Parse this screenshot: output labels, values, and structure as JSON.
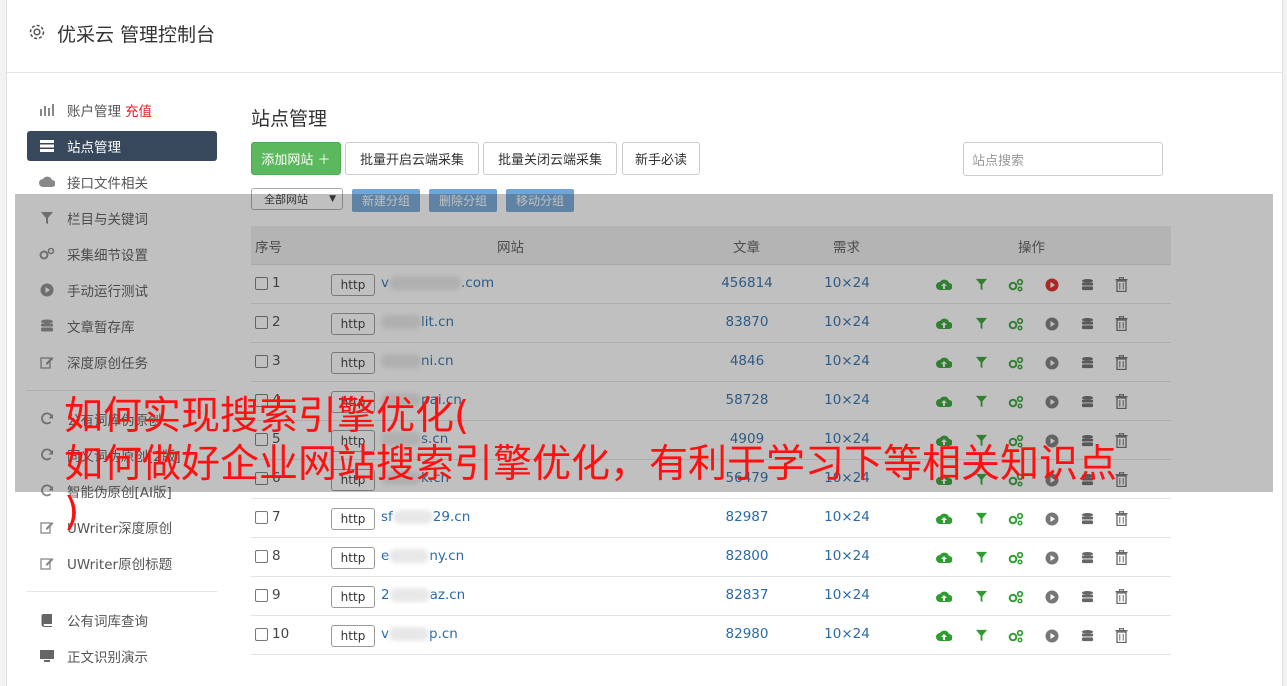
{
  "app": {
    "title": "优采云 管理控制台"
  },
  "sidebar": {
    "items": [
      {
        "label": "账户管理",
        "extra": "充值",
        "icon": "bar-chart-icon"
      },
      {
        "label": "站点管理",
        "icon": "server-icon",
        "active": true
      },
      {
        "label": "接口文件相关",
        "icon": "cloud-upload-icon"
      },
      {
        "label": "栏目与关键词",
        "icon": "filter-icon"
      },
      {
        "label": "采集细节设置",
        "icon": "gears-icon"
      },
      {
        "label": "手动运行测试",
        "icon": "play-circle-icon"
      },
      {
        "label": "文章暂存库",
        "icon": "database-icon"
      },
      {
        "label": "深度原创任务",
        "icon": "edit-icon"
      }
    ],
    "items2": [
      {
        "label": "公有词库伪原创",
        "icon": "refresh-icon"
      },
      {
        "label": "同义词伪原创[2版]",
        "icon": "refresh-icon"
      },
      {
        "label": "智能伪原创[AI版]",
        "icon": "refresh-icon"
      },
      {
        "label": "UWriter深度原创",
        "icon": "edit-icon"
      },
      {
        "label": "UWriter原创标题",
        "icon": "edit-icon"
      }
    ],
    "items3": [
      {
        "label": "公有词库查询",
        "icon": "book-icon"
      },
      {
        "label": "正文识别演示",
        "icon": "monitor-icon"
      }
    ]
  },
  "main": {
    "title": "站点管理",
    "buttons": {
      "add": "添加网站 ＋",
      "batch_open": "批量开启云端采集",
      "batch_close": "批量关闭云端采集",
      "guide": "新手必读"
    },
    "search_placeholder": "站点搜索",
    "group_select": "全部网站",
    "group_buttons": [
      "新建分组",
      "删除分组",
      "移动分组"
    ],
    "table": {
      "headers": [
        "序号",
        "网站",
        "文章",
        "需求",
        "操作"
      ],
      "rows": [
        {
          "num": "1",
          "prefix": "v",
          "suffix": ".com",
          "count": "456814",
          "need": "10×24"
        },
        {
          "num": "2",
          "prefix": "",
          "suffix": "lit.cn",
          "count": "83870",
          "need": "10×24"
        },
        {
          "num": "3",
          "prefix": "",
          "suffix": "ni.cn",
          "count": "4846",
          "need": "10×24"
        },
        {
          "num": "4",
          "prefix": "",
          "suffix": "pai.cn",
          "count": "58728",
          "need": "10×24"
        },
        {
          "num": "5",
          "prefix": "",
          "suffix": "s.cn",
          "count": "4909",
          "need": "10×24"
        },
        {
          "num": "6",
          "prefix": "",
          "suffix": "k.cn",
          "count": "56479",
          "need": "10×24"
        },
        {
          "num": "7",
          "prefix": "sf",
          "suffix": "29.cn",
          "count": "82987",
          "need": "10×24"
        },
        {
          "num": "8",
          "prefix": "e",
          "suffix": "ny.cn",
          "count": "82800",
          "need": "10×24"
        },
        {
          "num": "9",
          "prefix": "2",
          "suffix": "az.cn",
          "count": "82837",
          "need": "10×24"
        },
        {
          "num": "10",
          "prefix": "v",
          "suffix": "p.cn",
          "count": "82980",
          "need": "10×24"
        }
      ]
    }
  },
  "overlay": {
    "line1": "如何实现搜索引擎优化(",
    "line2": "如何做好企业网站搜索引擎优化，有利于学习下等相关知识点",
    "line3": ")"
  },
  "colors": {
    "green": "#2e9e2e",
    "red": "#e02020",
    "link": "#2a6aa8",
    "sidebar_active": "#37485d"
  }
}
